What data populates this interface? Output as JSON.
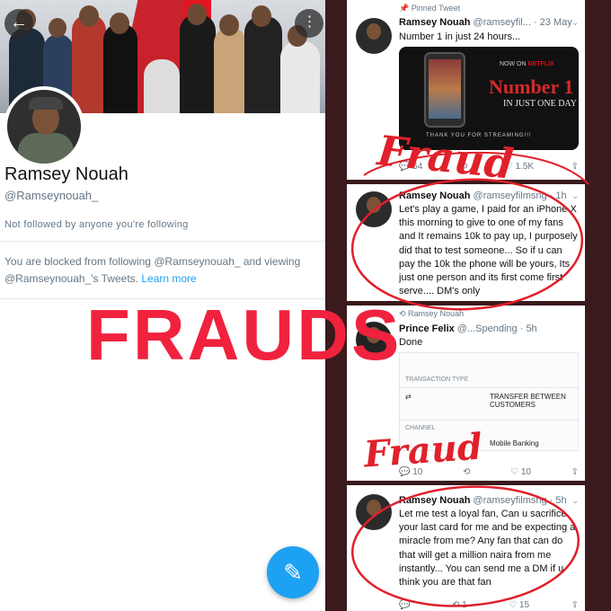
{
  "profile": {
    "back_icon": "arrow-left-icon",
    "more_icon": "more-vertical-icon",
    "name": "Ramsey Nouah",
    "handle": "@Ramseynouah_",
    "followed_text": "Not followed by anyone you're following",
    "blocked_text": "You are blocked from following @Ramseynouah_ and viewing @Ramseynouah_'s Tweets.",
    "learn_more": "Learn more",
    "compose_icon": "compose-tweet-icon"
  },
  "tweets": [
    {
      "pinned_label": "Pinned Tweet",
      "name": "Ramsey Nouah",
      "handle": "@ramseyfil...",
      "time": "· 23 May",
      "text": "Number 1 in just 24 hours...",
      "image": {
        "now_on": "NOW ON",
        "brand": "NETFLIX",
        "headline": "Number 1",
        "subline": "IN JUST ONE DAY",
        "thanks": "THANK YOU FOR STREAMING!!!"
      },
      "actions": {
        "replies": "54",
        "retweets": "",
        "likes": "1.5K"
      }
    },
    {
      "name": "Ramsey Nouah",
      "handle": "@ramseyfilmsng",
      "time": "· 1h",
      "text": "Let's play a game, I paid for an iPhone X this morning to give to one of my fans and It remains 10k to pay up, I purposely did that to test someone... So if u can pay the 10k the phone will be yours, Its just one person and its first come first serve.... DM's only"
    },
    {
      "retweet_label": "Ramsey Nouah",
      "name": "Prince Felix",
      "handle": "@...Spending",
      "time": "· 5h",
      "text": "Done",
      "transaction": {
        "type_label": "TRANSACTION TYPE",
        "type_value": "TRANSFER BETWEEN CUSTOMERS",
        "channel_label": "CHANNEL",
        "channel_value": "Mobile Banking"
      },
      "actions": {
        "replies": "10",
        "retweets": "",
        "likes": "10"
      }
    },
    {
      "name": "Ramsey Nouah",
      "handle": "@ramseyfilmsng",
      "time": "· 5h",
      "text": "Let me test a loyal fan, Can u sacrifice your last card for me and be expecting a miracle from me? Any fan that can do that will get a million naira from me instantly... You can send me a DM if u think you are that fan",
      "actions": {
        "replies": "",
        "retweets": "1",
        "likes": "15"
      }
    }
  ],
  "overlay": {
    "headline": "FRAUDS",
    "annotation_1": "Fraud",
    "annotation_2": "Fraud",
    "color": "#f0223e"
  }
}
